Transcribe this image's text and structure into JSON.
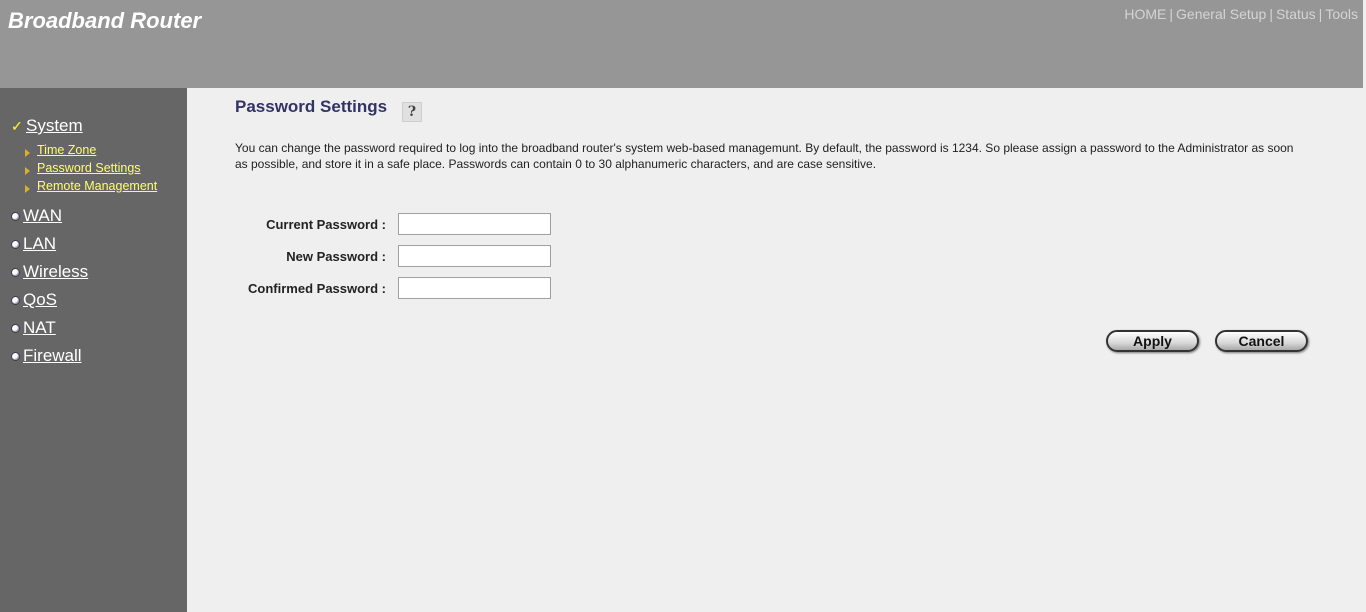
{
  "header": {
    "brand": "Broadband Router",
    "topnav": [
      {
        "label": "HOME"
      },
      {
        "label": "General Setup"
      },
      {
        "label": "Status"
      },
      {
        "label": "Tools"
      }
    ],
    "separator": "|"
  },
  "sidebar": {
    "system": {
      "label": "System",
      "icon": "check-icon",
      "check_glyph": "✓",
      "subitems": [
        {
          "label": "Time Zone"
        },
        {
          "label": "Password Settings"
        },
        {
          "label": "Remote Management"
        }
      ]
    },
    "items": [
      {
        "label": "WAN"
      },
      {
        "label": "LAN"
      },
      {
        "label": "Wireless"
      },
      {
        "label": "QoS"
      },
      {
        "label": "NAT"
      },
      {
        "label": "Firewall"
      }
    ]
  },
  "main": {
    "title": "Password Settings",
    "help_glyph": "?",
    "description": "You can change the password required to log into the broadband router's system web-based managemunt. By default, the password is 1234. So please assign a password to the Administrator as soon as possible, and store it in a safe place. Passwords can contain 0 to 30 alphanumeric characters, and are case sensitive.",
    "fields": [
      {
        "label": "Current Password :",
        "value": ""
      },
      {
        "label": "New Password :",
        "value": ""
      },
      {
        "label": "Confirmed Password :",
        "value": ""
      }
    ],
    "buttons": {
      "apply": "Apply",
      "cancel": "Cancel"
    }
  },
  "colors": {
    "header_bg": "#969696",
    "sidebar_bg": "#666666",
    "content_bg": "#efefef",
    "title_color": "#333366",
    "submenu_link": "#ffff66"
  }
}
